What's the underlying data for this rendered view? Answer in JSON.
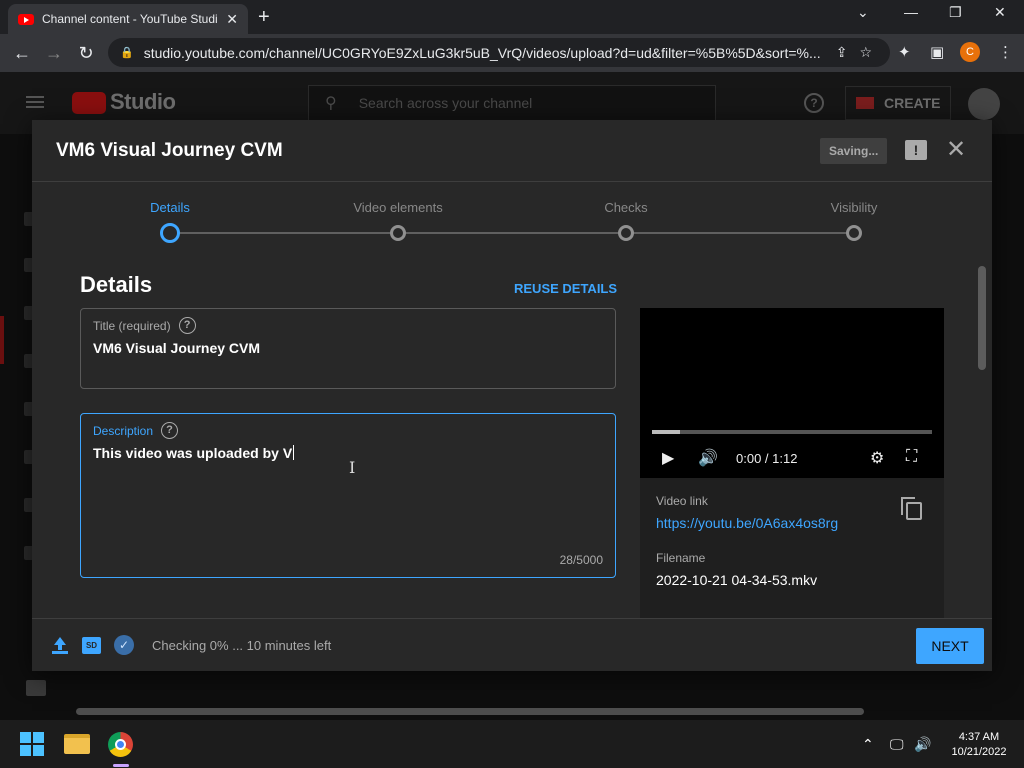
{
  "browser": {
    "tab_title": "Channel content - YouTube Studio",
    "url": "studio.youtube.com/channel/UC0GRYoE9ZxLuG3kr5uB_VrQ/videos/upload?d=ud&filter=%5B%5D&sort=%...",
    "profile_initial": "C"
  },
  "studio": {
    "logo_text": "Studio",
    "search_placeholder": "Search across your channel",
    "create_label": "CREATE"
  },
  "modal": {
    "title": "VM6 Visual Journey CVM",
    "saving_label": "Saving...",
    "steps": [
      "Details",
      "Video elements",
      "Checks",
      "Visibility"
    ],
    "active_step": 0,
    "section_heading": "Details",
    "reuse_label": "REUSE DETAILS",
    "title_field": {
      "label": "Title (required)",
      "value": "VM6 Visual Journey CVM"
    },
    "description_field": {
      "label": "Description",
      "value": "This video was uploaded by V",
      "counter": "28/5000"
    },
    "player": {
      "time": "0:00 / 1:12",
      "progress_fraction": 0.1
    },
    "video_info": {
      "link_label": "Video link",
      "link_url": "https://youtu.be/0A6ax4os8rg",
      "filename_label": "Filename",
      "filename": "2022-10-21 04-34-53.mkv"
    },
    "footer": {
      "sd_badge": "SD",
      "status": "Checking 0% ... 10 minutes left",
      "next_label": "NEXT"
    }
  },
  "taskbar": {
    "time": "4:37 AM",
    "date": "10/21/2022"
  },
  "colors": {
    "accent": "#3ea6ff",
    "modal_bg": "#282828",
    "brand_red": "#ff0000"
  }
}
